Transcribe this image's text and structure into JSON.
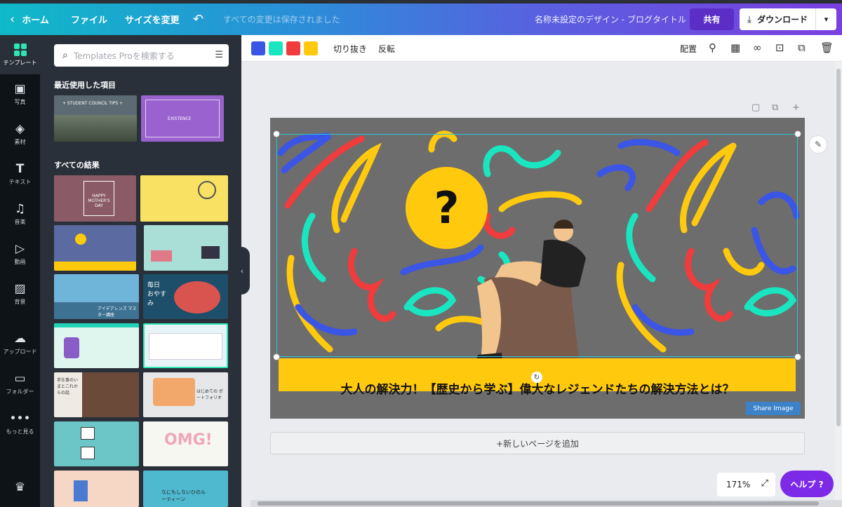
{
  "topbar": {
    "home": "ホーム",
    "file": "ファイル",
    "resize": "サイズを変更",
    "undo_icon": "undo-icon",
    "saved_status": "すべての変更は保存されました",
    "design_title": "名称未設定のデザイン - ブログタイトル",
    "share": "共有",
    "download": "ダウンロード"
  },
  "leftnav": {
    "items": [
      {
        "label": "テンプレート",
        "icon": "template-icon"
      },
      {
        "label": "写真",
        "icon": "photo-icon"
      },
      {
        "label": "素材",
        "icon": "elements-icon"
      },
      {
        "label": "テキスト",
        "icon": "text-icon"
      },
      {
        "label": "音楽",
        "icon": "music-icon"
      },
      {
        "label": "動画",
        "icon": "video-icon"
      },
      {
        "label": "背景",
        "icon": "background-icon"
      },
      {
        "label": "アップロード",
        "icon": "upload-icon"
      },
      {
        "label": "フォルダー",
        "icon": "folder-icon"
      },
      {
        "label": "もっと見る",
        "icon": "more-icon"
      }
    ]
  },
  "panel": {
    "search_placeholder": "Templates Proを検索する",
    "recent_title": "最近使用した項目",
    "all_title": "すべての結果",
    "recent": [
      {
        "text": "+ STUDENT COUNCIL TIPS +",
        "bg": "#5c6a73"
      },
      {
        "text": "EXISTENCE",
        "bg": "#9a62cf"
      }
    ],
    "results": [
      {
        "text": "HAPPY MOTHER'S DAY",
        "bg": "#8a5a66"
      },
      {
        "text": "",
        "bg": "#f8e163"
      },
      {
        "text": "",
        "bg": "#5b6aa0"
      },
      {
        "text": "",
        "bg": "#a9dfd6"
      },
      {
        "text": "アイデアレンズ マスター講座",
        "bg": "#6fb4d9"
      },
      {
        "text": "毎日 おやすみ",
        "bg": "#1d4f6a"
      },
      {
        "text": "",
        "bg": "#dff6ee"
      },
      {
        "text": "",
        "bg": "#e7f3f6"
      },
      {
        "text": "手仕事のいまとこれからの話",
        "bg": "#efeae3"
      },
      {
        "text": "はじめての ポートフォリオ",
        "bg": "#e5e7e9"
      },
      {
        "text": "",
        "bg": "#6cc6c8"
      },
      {
        "text": "OMG!",
        "bg": "#f7f7f2"
      },
      {
        "text": "",
        "bg": "#f6d6c4"
      },
      {
        "text": "なにもしないひのルーティーン",
        "bg": "#4fb9cf"
      }
    ]
  },
  "toolbar": {
    "colors": [
      "#3b55e6",
      "#19e6c1",
      "#f03c3c",
      "#ffc90e"
    ],
    "crop": "切り抜き",
    "flip": "反転",
    "position": "配置"
  },
  "design": {
    "headline": "大人の解決力！【歴史から学ぶ】偉大なレジェンドたちの解決方法とは？",
    "question_mark": "?",
    "share_image": "Share Image"
  },
  "canvas": {
    "add_page": "+新しいページを追加",
    "zoom": "171%",
    "help": "ヘルプ ?"
  }
}
